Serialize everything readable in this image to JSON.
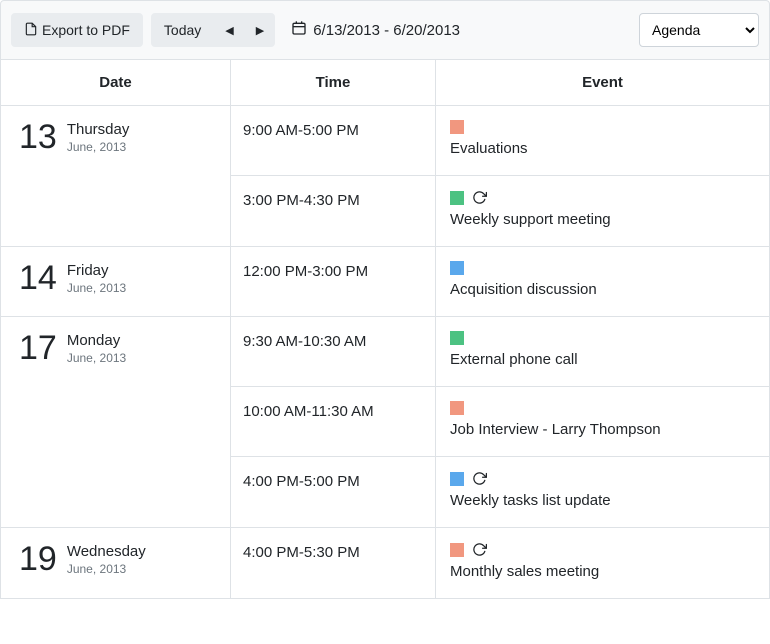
{
  "toolbar": {
    "export_label": "Export to PDF",
    "today_label": "Today",
    "date_range": "6/13/2013 - 6/20/2013",
    "view_select": "Agenda"
  },
  "headers": {
    "date": "Date",
    "time": "Time",
    "event": "Event"
  },
  "colors": {
    "salmon": "#f1977f",
    "green": "#4cc282",
    "blue": "#5aa8ec"
  },
  "days": [
    {
      "daynum": "13",
      "dow": "Thursday",
      "monthyear": "June, 2013",
      "events": [
        {
          "time": "9:00 AM-5:00 PM",
          "title": "Evaluations",
          "color": "salmon",
          "recurring": false
        },
        {
          "time": "3:00 PM-4:30 PM",
          "title": "Weekly support meeting",
          "color": "green",
          "recurring": true
        }
      ]
    },
    {
      "daynum": "14",
      "dow": "Friday",
      "monthyear": "June, 2013",
      "events": [
        {
          "time": "12:00 PM-3:00 PM",
          "title": "Acquisition discussion",
          "color": "blue",
          "recurring": false
        }
      ]
    },
    {
      "daynum": "17",
      "dow": "Monday",
      "monthyear": "June, 2013",
      "events": [
        {
          "time": "9:30 AM-10:30 AM",
          "title": "External phone call",
          "color": "green",
          "recurring": false
        },
        {
          "time": "10:00 AM-11:30 AM",
          "title": "Job Interview - Larry Thompson",
          "color": "salmon",
          "recurring": false
        },
        {
          "time": "4:00 PM-5:00 PM",
          "title": "Weekly tasks list update",
          "color": "blue",
          "recurring": true
        }
      ]
    },
    {
      "daynum": "19",
      "dow": "Wednesday",
      "monthyear": "June, 2013",
      "events": [
        {
          "time": "4:00 PM-5:30 PM",
          "title": "Monthly sales meeting",
          "color": "salmon",
          "recurring": true
        }
      ]
    }
  ]
}
